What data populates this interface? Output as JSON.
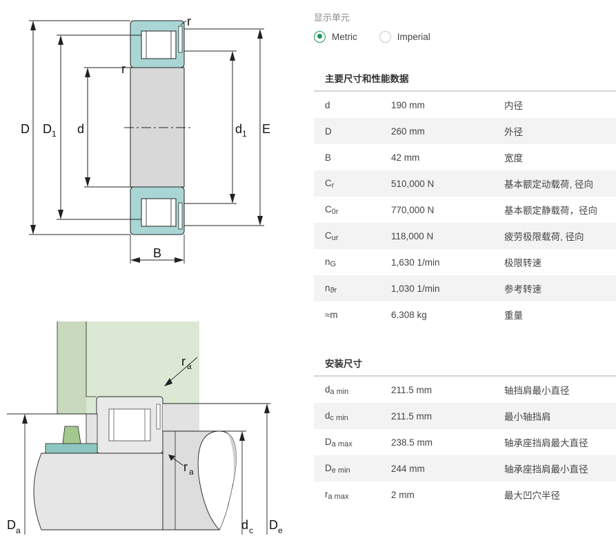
{
  "unit_selector": {
    "title": "显示单元",
    "options": [
      {
        "label": "Metric",
        "selected": true
      },
      {
        "label": "Imperial",
        "selected": false
      }
    ]
  },
  "main_dimensions": {
    "title": "主要尺寸和性能数据",
    "rows": [
      {
        "sym": "d",
        "sub": "",
        "value": "190 mm",
        "desc": "内径"
      },
      {
        "sym": "D",
        "sub": "",
        "value": "260 mm",
        "desc": "外径"
      },
      {
        "sym": "B",
        "sub": "",
        "value": "42 mm",
        "desc": "宽度"
      },
      {
        "sym": "C",
        "sub": "r",
        "value": "510,000 N",
        "desc": "基本额定动载荷, 径向"
      },
      {
        "sym": "C",
        "sub": "0r",
        "value": "770,000 N",
        "desc": "基本额定静载荷，径向"
      },
      {
        "sym": "C",
        "sub": "ur",
        "value": "118,000 N",
        "desc": "疲劳极限载荷, 径向"
      },
      {
        "sym": "n",
        "sub": "G",
        "value": "1,630 1/min",
        "desc": "极限转速"
      },
      {
        "sym": "n",
        "sub": "ϑr",
        "value": "1,030 1/min",
        "desc": "参考转速"
      },
      {
        "sym": "≈m",
        "sub": "",
        "value": "6.308 kg",
        "desc": "重量"
      }
    ]
  },
  "mounting_dimensions": {
    "title": "安装尺寸",
    "rows": [
      {
        "sym": "d",
        "sub": "a min",
        "value": "211.5 mm",
        "desc": "轴挡肩最小直径"
      },
      {
        "sym": "d",
        "sub": "c min",
        "value": "211.5 mm",
        "desc": "最小轴挡肩"
      },
      {
        "sym": "D",
        "sub": "a max",
        "value": "238.5 mm",
        "desc": "轴承座挡肩最大直径"
      },
      {
        "sym": "D",
        "sub": "e min",
        "value": "244 mm",
        "desc": "轴承座挡肩最小直径"
      },
      {
        "sym": "r",
        "sub": "a max",
        "value": "2 mm",
        "desc": "最大凹穴半径"
      }
    ]
  },
  "drawing_top": {
    "labels": {
      "D": "D",
      "D1": "D",
      "D1_sub": "1",
      "d": "d",
      "d1": "d",
      "d1_sub": "1",
      "E": "E",
      "B": "B",
      "r_top": "r",
      "r_mid": "r"
    }
  },
  "drawing_bottom": {
    "labels": {
      "ra_top": "r",
      "ra_top_sub": "a",
      "ra_bottom": "r",
      "ra_bottom_sub": "a",
      "Da": "D",
      "Da_sub": "a",
      "dc": "d",
      "dc_sub": "c",
      "De": "D",
      "De_sub": "e"
    }
  },
  "colors": {
    "accent": "#1a9a5a",
    "ring": "#a9d6d4",
    "shaft_green": "#dbe8d3",
    "body_gray": "#d8d8d8"
  }
}
